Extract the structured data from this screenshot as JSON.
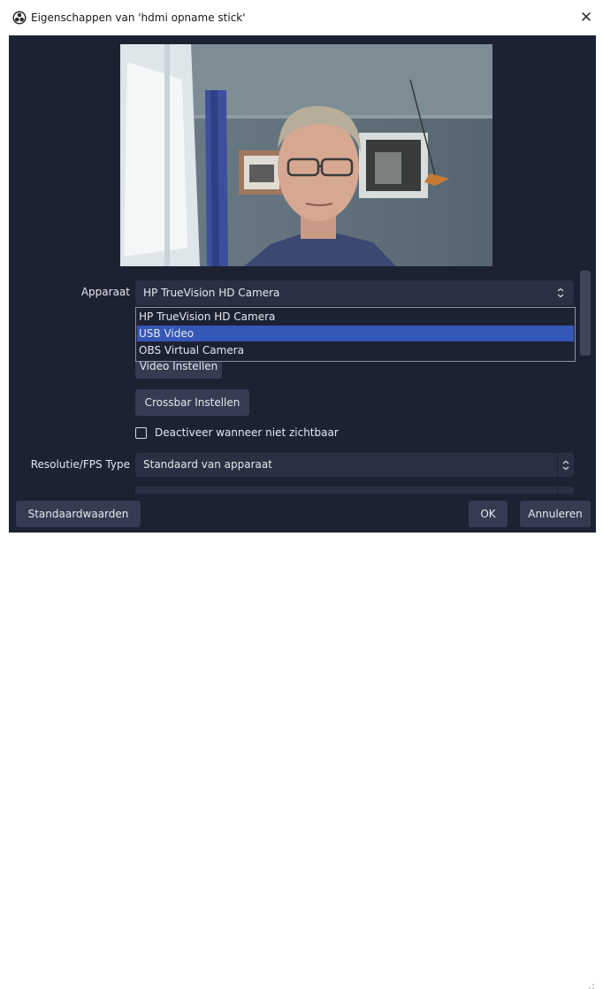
{
  "window": {
    "title": "Eigenschappen van 'hdmi opname stick'",
    "close_glyph": "✕"
  },
  "preview": {
    "description_icon": "camera-preview-image"
  },
  "device": {
    "label": "Apparaat",
    "value": "HP TrueVision HD Camera",
    "options": [
      {
        "label": "HP TrueVision HD Camera",
        "selected": false
      },
      {
        "label": "USB Video",
        "selected": true
      },
      {
        "label": "OBS Virtual Camera",
        "selected": false
      }
    ]
  },
  "buttons": {
    "video_settings": "Video Instellen",
    "crossbar_settings": "Crossbar Instellen",
    "defaults": "Standaardwaarden",
    "ok": "OK",
    "cancel": "Annuleren"
  },
  "deactivate": {
    "label": "Deactiveer wanneer niet zichtbaar",
    "checked": false
  },
  "resolution": {
    "label": "Resolutie/FPS Type",
    "value": "Standaard van apparaat"
  },
  "colors": {
    "panel": "#1d2233",
    "control": "#2a3041",
    "button": "#353c51",
    "selection": "#3557b7"
  }
}
